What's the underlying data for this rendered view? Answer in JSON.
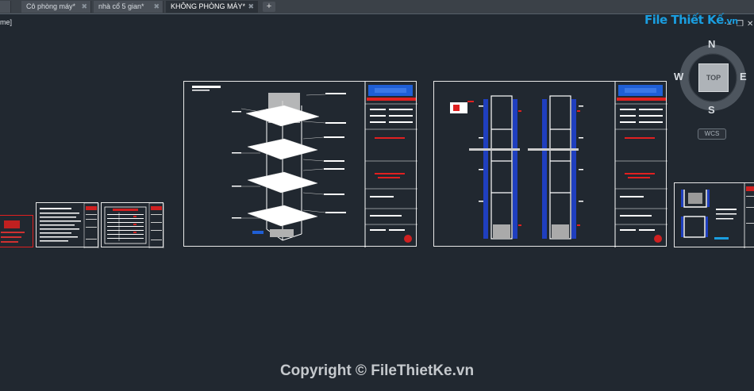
{
  "tabs": [
    {
      "label": "Cô phòng máy*"
    },
    {
      "label": "nhà cổ 5 gian*"
    },
    {
      "label": "KHÔNG PHÒNG MÁY*"
    }
  ],
  "new_tab_label": "+",
  "tab_close": "✖",
  "viewport_label": "me]",
  "window_controls": {
    "minimize": "–",
    "restore": "❐",
    "close": "✕"
  },
  "logo": {
    "main": "File Thiết Kế",
    "suffix": ".vn",
    "color": "#1a9ee0"
  },
  "viewcube": {
    "north": "N",
    "south": "S",
    "east": "E",
    "west": "W",
    "face": "TOP",
    "wcs": "WCS"
  },
  "copyright": "Copyright © FileThietKe.vn",
  "colors": {
    "background": "#212830",
    "accent_red": "#e02020",
    "accent_blue": "#1a9ee0",
    "lines": "#e8e8e8"
  }
}
